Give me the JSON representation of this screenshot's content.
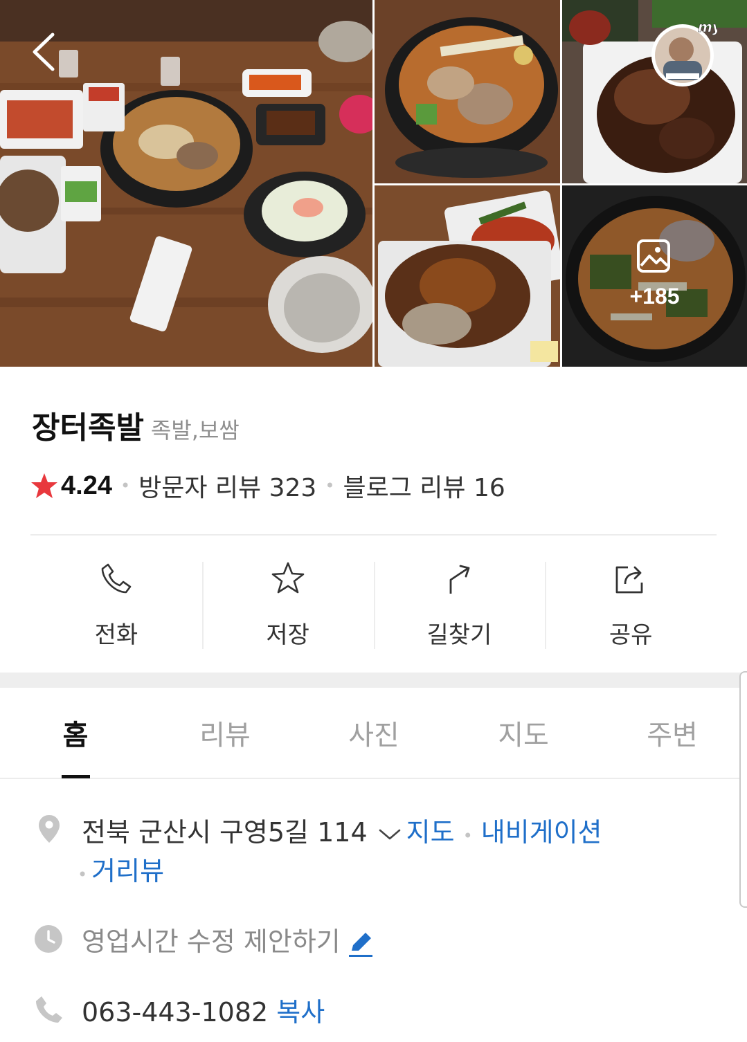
{
  "place": {
    "name": "장터족발",
    "category": "족발,보쌈",
    "rating": "4.24",
    "visitor_reviews": "방문자 리뷰 323",
    "blog_reviews": "블로그 리뷰 16"
  },
  "gallery": {
    "more_count": "+185",
    "badge_text": "my"
  },
  "actions": [
    {
      "label": "전화",
      "icon": "phone-icon"
    },
    {
      "label": "저장",
      "icon": "star-outline-icon"
    },
    {
      "label": "길찾기",
      "icon": "directions-arrow-icon"
    },
    {
      "label": "공유",
      "icon": "share-icon"
    }
  ],
  "tabs": [
    {
      "label": "홈",
      "active": true
    },
    {
      "label": "리뷰",
      "active": false
    },
    {
      "label": "사진",
      "active": false
    },
    {
      "label": "지도",
      "active": false
    },
    {
      "label": "주변",
      "active": false
    }
  ],
  "info": {
    "address": "전북 군산시 구영5길 114",
    "map_link": "지도",
    "navigation_link": "내비게이션",
    "street_view_link": "거리뷰",
    "hours_suggest": "영업시간 수정 제안하기",
    "phone": "063-443-1082",
    "copy_link": "복사"
  },
  "colors": {
    "accent_blue": "#1f6fc9",
    "rating_star": "#e8383d",
    "icon_gray": "#c6c6c6"
  }
}
